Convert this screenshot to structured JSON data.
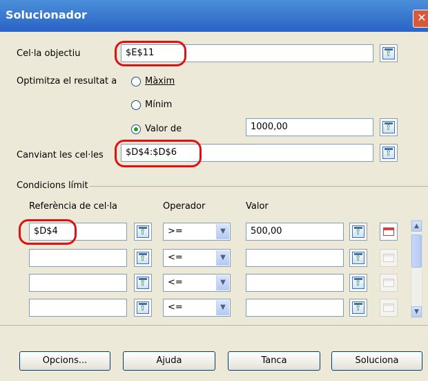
{
  "dialog": {
    "title": "Solucionador"
  },
  "target_cell": {
    "label": "Cel·la objectiu",
    "value": "$E$11"
  },
  "optimize": {
    "label": "Optimitza el resultat a",
    "maximum_label": "Màxim",
    "minimum_label": "Mínim",
    "value_of_label": "Valor de",
    "value_of_value": "1000,00",
    "selected": "value_of"
  },
  "changing_cells": {
    "label": "Canviant les cel·les",
    "value": "$D$4:$D$6"
  },
  "constraints": {
    "section_label": "Condicions límit",
    "columns": {
      "ref": "Referència de cel·la",
      "operator": "Operador",
      "value": "Valor"
    },
    "rows": [
      {
        "ref": "$D$4",
        "operator": ">=",
        "value": "500,00"
      },
      {
        "ref": "",
        "operator": "<=",
        "value": ""
      },
      {
        "ref": "",
        "operator": "<=",
        "value": ""
      },
      {
        "ref": "",
        "operator": "<=",
        "value": ""
      }
    ]
  },
  "buttons": {
    "options": "Opcions...",
    "help": "Ajuda",
    "close": "Tanca",
    "solve": "Soluciona"
  },
  "colors": {
    "highlight": "#E01010",
    "titlebar": "#2A63C5",
    "dialog_bg": "#ECE9D8"
  }
}
